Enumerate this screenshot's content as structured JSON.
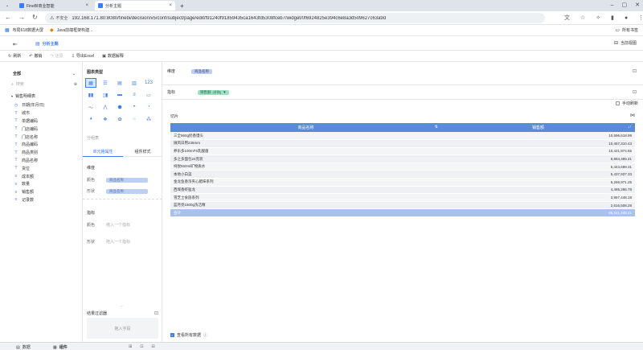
{
  "browser": {
    "tabs": [
      {
        "label": "FineBI商业智能"
      },
      {
        "label": "分析主题"
      }
    ],
    "nav": {
      "security": "不安全",
      "url": "192.168.171.80:8080/finebi/decision/v5/conf/subject/page/edit/f91240f91859435ca1643fd5308fceb7/widget/0f6924825e394c6e8a3d509627c63a9d"
    },
    "bookmarks": [
      {
        "label": "布局618数据大屏"
      },
      {
        "label": "Java前端框架构建..."
      }
    ],
    "all_bookmarks": "所有书签"
  },
  "app": {
    "tab_title": "分析主题",
    "right_tab_label": "当前视图",
    "toolbar": {
      "refresh": "刷新",
      "undo": "撤销",
      "redo": "还原",
      "export": "导出Excel",
      "explain": "数据解释"
    },
    "left": {
      "scope": "全部",
      "search_placeholder": "搜索",
      "group": "销售明细表",
      "fields": [
        {
          "type": "clock",
          "name": "日期(年月日)"
        },
        {
          "type": "T",
          "name": "城市"
        },
        {
          "type": "T",
          "name": "单据编码"
        },
        {
          "type": "T",
          "name": "门店编码"
        },
        {
          "type": "T",
          "name": "门店名称"
        },
        {
          "type": "T",
          "name": "商品编码"
        },
        {
          "type": "T",
          "name": "商品类别"
        },
        {
          "type": "T",
          "name": "商品名称"
        },
        {
          "type": "T",
          "name": "货位"
        },
        {
          "type": "#",
          "name": "成本额"
        },
        {
          "type": "#",
          "name": "数量"
        },
        {
          "type": "#",
          "name": "销售额"
        },
        {
          "type": "#",
          "name": "记录数"
        }
      ]
    },
    "middle": {
      "chart_type_label": "图表类型",
      "chart_icons": [
        "table-icon",
        "detail-table-icon",
        "cross-table-icon",
        "summary-table-icon",
        "kpi-icon",
        "bar-chart-icon",
        "grouped-bar-icon",
        "stacked-bar-icon",
        "horizontal-bar-icon",
        "range-bar-icon",
        "line-chart-icon",
        "area-chart-icon",
        "radar-icon",
        "dashboard-icon",
        "gauge-icon",
        "pie-chart-icon",
        "multi-pie-icon",
        "rose-icon",
        "scatter-icon",
        "bubble-icon"
      ],
      "subtype_label": "分组表",
      "tab_cell": "单元格属性",
      "tab_component": "组件样式",
      "dimension_label": "维度",
      "color_label": "颜色",
      "shape_label": "形状",
      "color_value": "商品名称",
      "shape_value": "商品名称",
      "metric_label": "指标",
      "metric_color_label": "颜色",
      "metric_shape_label": "形状",
      "metric_color_placeholder": "拖入一个指标",
      "metric_shape_placeholder": "拖入一个指标",
      "result_filter_label": "结果过滤器",
      "drag_field": "拖入字段"
    },
    "right": {
      "dimension_label": "维度",
      "dimension_chip": "商品名称",
      "metric_label": "指标",
      "metric_chip": "销售额",
      "metric_chip_sub": "(求和)",
      "manual_refresh": "手动刷新",
      "component_title": "切片",
      "table": {
        "headers": [
          "商品名称",
          "销售额"
        ],
        "rows": [
          [
            "三全960g奶香馒头",
            "10,596,618.99"
          ],
          [
            "微风日用245mm",
            "10,457,310.43"
          ],
          [
            "养乐多100ml*5乳酸菌",
            "10,421,974.65"
          ],
          [
            "多之多面包24克装",
            "6,864,495.21"
          ],
          [
            "纯悦550ml矿物质水",
            "5,443,698.31"
          ],
          [
            "本地小白菜",
            "5,437,937.33"
          ],
          [
            "金龙鱼香浓夹心腊味系列",
            "5,266,971.25"
          ],
          [
            "西域香虾猛龙",
            "4,485,286.78"
          ],
          [
            "雪芝士食族系列",
            "3,957,448.19"
          ],
          [
            "蓝月亮1500g洗洁精",
            "2,616,508.28"
          ]
        ],
        "total_label": "合计",
        "total_value": "65,241,448.41"
      },
      "view_all": "查看所有数据"
    },
    "bottom": {
      "tab1": "数据",
      "tab2": "组件"
    }
  },
  "colors": {
    "accent": "#3d7cf2",
    "table_header": "#5a8bd8",
    "total_row": "#a9c2ea",
    "metric_chip": "#9fe0c5"
  }
}
